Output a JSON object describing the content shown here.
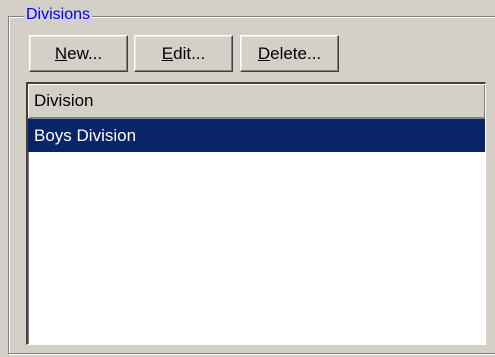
{
  "group": {
    "title": "Divisions"
  },
  "buttons": {
    "new": {
      "mnemonic": "N",
      "rest": "ew..."
    },
    "edit": {
      "mnemonic": "E",
      "rest": "dit..."
    },
    "delete": {
      "mnemonic": "D",
      "rest": "elete..."
    }
  },
  "list": {
    "columns": [
      "Division"
    ],
    "rows": [
      {
        "division": "Boys Division",
        "selected": true
      }
    ]
  },
  "colors": {
    "legend_text": "#0000ff",
    "selection_bg": "#0a246a",
    "selection_text": "#ffffff",
    "face": "#d4d0c8"
  }
}
